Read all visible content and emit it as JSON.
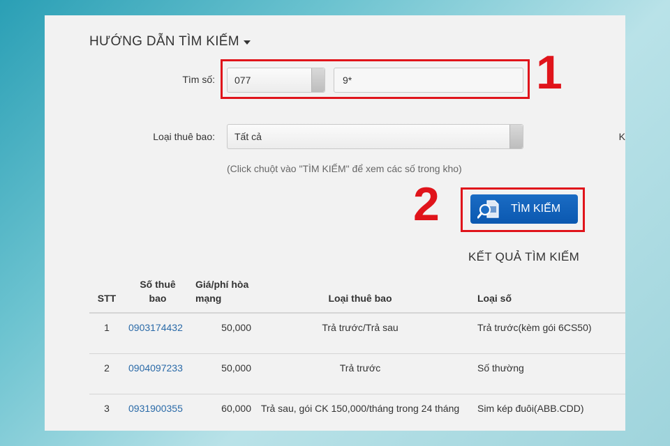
{
  "guide": {
    "title": "HƯỚNG DẪN TÌM KIẾM",
    "caret_icon": "caret-down-icon"
  },
  "search": {
    "label": "Tìm số:",
    "prefix_value": "077",
    "pattern_value": "9*"
  },
  "subscriber": {
    "label": "Loại thuê bao:",
    "selected": "Tất cả"
  },
  "edge_text": "K",
  "hint": "(Click chuột vào \"TÌM KIẾM\" để xem các số trong kho)",
  "steps": {
    "one": "1",
    "two": "2"
  },
  "search_button": {
    "label": "TÌM KIẾM",
    "icon": "sim-search-icon"
  },
  "results": {
    "title": "KẾT QUẢ TÌM KIẾM",
    "headers": {
      "stt": "STT",
      "number_l1": "Số thuê",
      "number_l2": "bao",
      "price_l1": "Giá/phí hòa",
      "price_l2": "mạng",
      "type": "Loại thuê bao",
      "kind": "Loại số"
    },
    "rows": [
      {
        "stt": "1",
        "number": "0903174432",
        "price": "50,000",
        "type": "Trả trước/Trả sau",
        "kind": "Trả trước(kèm gói 6CS50)"
      },
      {
        "stt": "2",
        "number": "0904097233",
        "price": "50,000",
        "type": "Trả trước",
        "kind": "Số thường"
      },
      {
        "stt": "3",
        "number": "0931900355",
        "price": "60,000",
        "type": "Trả sau, gói CK 150,000/tháng trong 24 tháng",
        "kind": "Sim kép đuôi(ABB.CDD)"
      }
    ]
  },
  "colors": {
    "highlight": "#e0141b",
    "button": "#0b58b0",
    "link": "#2a6aa8"
  }
}
